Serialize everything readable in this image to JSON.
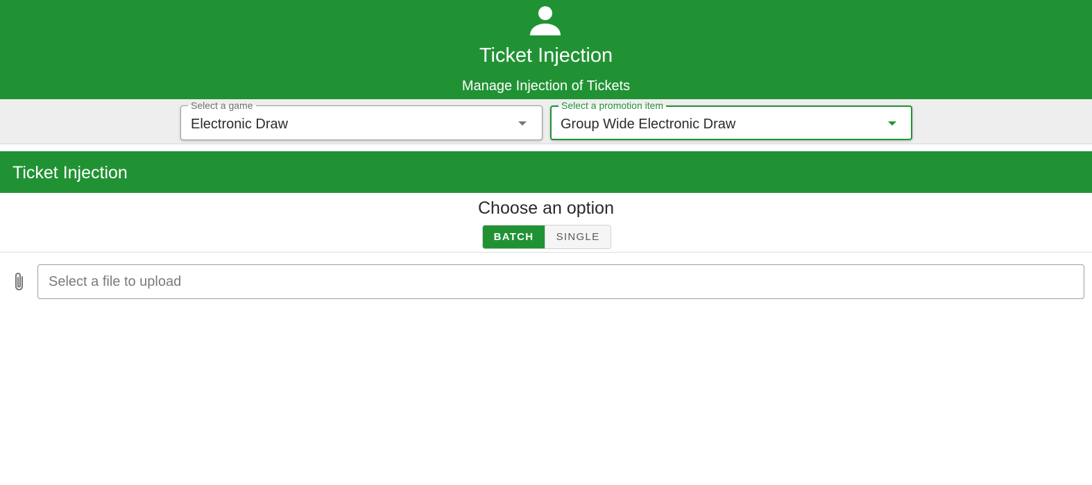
{
  "header": {
    "icon": "user-icon",
    "title": "Ticket Injection",
    "subtitle": "Manage Injection of Tickets",
    "background": "#219234"
  },
  "filters": {
    "game": {
      "label": "Select a game",
      "value": "Electronic Draw"
    },
    "promotion": {
      "label": "Select a promotion item",
      "value": "Group Wide Electronic Draw"
    }
  },
  "panel": {
    "title": "Ticket Injection",
    "prompt": "Choose an option",
    "options": [
      {
        "label": "BATCH",
        "selected": true
      },
      {
        "label": "SINGLE",
        "selected": false
      }
    ],
    "upload": {
      "icon": "paperclip-icon",
      "placeholder": "Select a file to upload",
      "value": ""
    }
  },
  "colors": {
    "accent": "#219234",
    "filter_bar": "#eeeeee"
  }
}
